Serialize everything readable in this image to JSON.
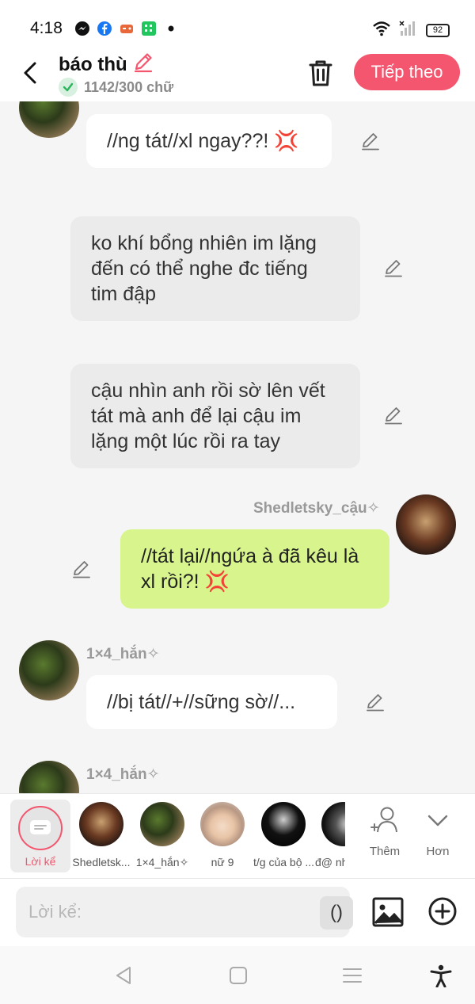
{
  "status": {
    "time": "4:18",
    "battery": "92"
  },
  "header": {
    "title": "báo thù",
    "word_count": "1142/300 chữ",
    "next_label": "Tiếp theo"
  },
  "messages": [
    {
      "text": "//ng tát//xl ngay??! 💢"
    },
    {
      "text": "ko khí bổng nhiên im lặng đến có thể nghe đc tiếng tim đập"
    },
    {
      "text": "cậu nhìn anh rồi sờ lên vết tát mà anh để lại cậu im lặng một lúc rồi ra tay"
    },
    {
      "name": "Shedletsky_cậu✧",
      "text": "//tát lại//ngứa à đã kêu là xl rồi?! 💢"
    },
    {
      "name": "1×4_hắn✧",
      "text": "//bị tát//+//sững sờ//..."
    },
    {
      "name": "1×4_hắn✧"
    }
  ],
  "characters": [
    {
      "label": "Lời kể"
    },
    {
      "label": "Shedletsk..."
    },
    {
      "label": "1×4_hắn✧"
    },
    {
      "label": "nữ 9"
    },
    {
      "label": "t/g của bộ ..."
    },
    {
      "label": "đ@ nh"
    }
  ],
  "actions": {
    "more_label": "Thêm",
    "less_label": "Hơn"
  },
  "input": {
    "placeholder": "Lời kể:",
    "paren": "()"
  },
  "colors": {
    "accent": "#f3566e",
    "green_bubble": "#d7f58c",
    "narration_bubble": "#ebebeb"
  }
}
